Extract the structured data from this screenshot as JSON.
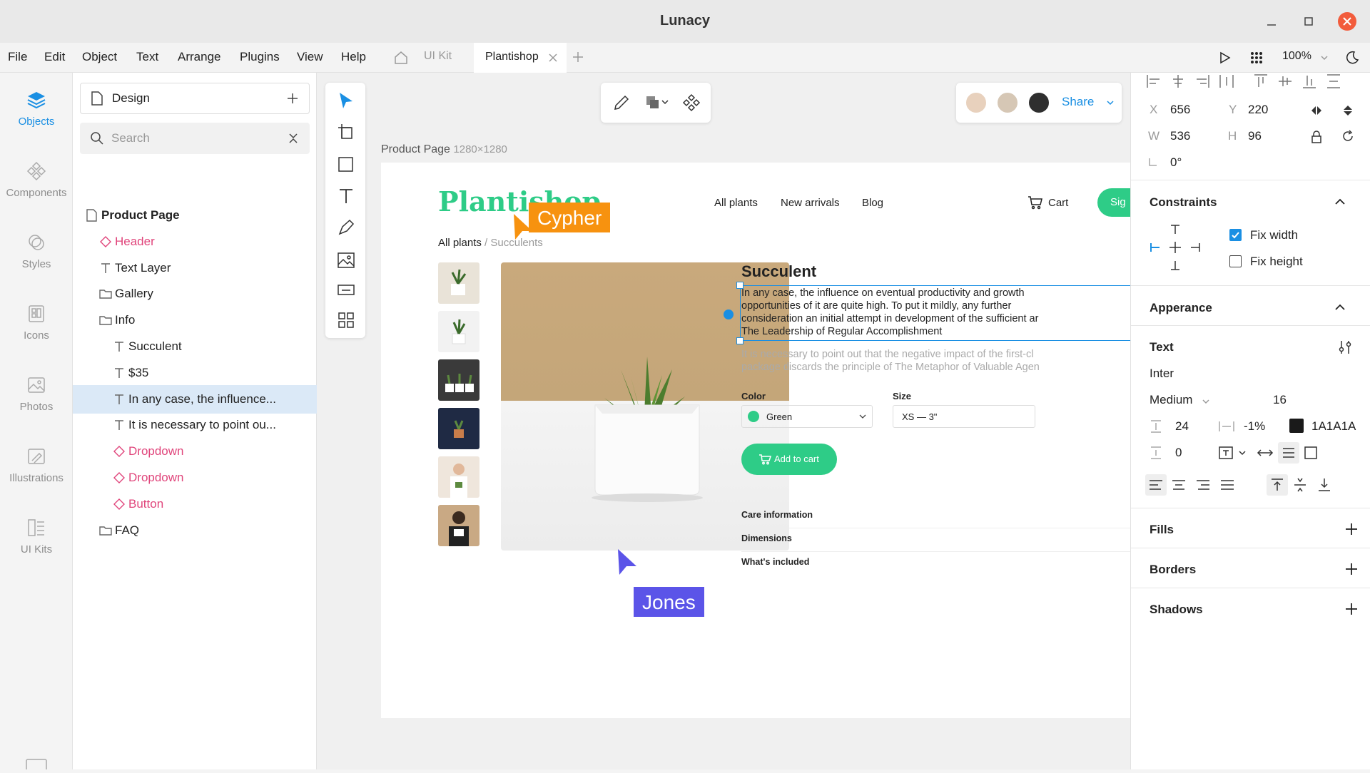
{
  "app": {
    "title": "Lunacy"
  },
  "menu": [
    "File",
    "Edit",
    "Object",
    "Text",
    "Arrange",
    "Plugins",
    "View",
    "Help"
  ],
  "tabs": {
    "kit": "UI Kit",
    "active": "Plantishop"
  },
  "toolbar_right": {
    "zoom": "100%"
  },
  "rail": [
    {
      "label": "Objects",
      "icon": "layers-icon",
      "active": true
    },
    {
      "label": "Components",
      "icon": "components-icon"
    },
    {
      "label": "Styles",
      "icon": "styles-icon"
    },
    {
      "label": "Icons",
      "icon": "icons-icon"
    },
    {
      "label": "Photos",
      "icon": "photos-icon"
    },
    {
      "label": "Illustrations",
      "icon": "illustrations-icon"
    },
    {
      "label": "UI Kits",
      "icon": "ui-kits-icon"
    }
  ],
  "pages": {
    "current": "Design"
  },
  "search": {
    "placeholder": "Search"
  },
  "layers": [
    {
      "label": "Product Page",
      "type": "page",
      "indent": 0,
      "color": "#222",
      "bold": true
    },
    {
      "label": "Header",
      "type": "component",
      "indent": 1,
      "color": "#e0457b"
    },
    {
      "label": "Text Layer",
      "type": "text",
      "indent": 1,
      "color": "#222"
    },
    {
      "label": "Gallery",
      "type": "folder",
      "indent": 1,
      "color": "#222"
    },
    {
      "label": "Info",
      "type": "folder",
      "indent": 1,
      "color": "#222"
    },
    {
      "label": "Succulent",
      "type": "text",
      "indent": 2,
      "color": "#222"
    },
    {
      "label": "$35",
      "type": "text",
      "indent": 2,
      "color": "#222"
    },
    {
      "label": "In any case, the influence...",
      "type": "text",
      "indent": 2,
      "color": "#222",
      "selected": true
    },
    {
      "label": "It is necessary to point ou...",
      "type": "text",
      "indent": 2,
      "color": "#222"
    },
    {
      "label": "Dropdown",
      "type": "component",
      "indent": 2,
      "color": "#e0457b"
    },
    {
      "label": "Dropdown",
      "type": "component",
      "indent": 2,
      "color": "#e0457b"
    },
    {
      "label": "Button",
      "type": "component",
      "indent": 2,
      "color": "#e0457b"
    },
    {
      "label": "FAQ",
      "type": "folder",
      "indent": 1,
      "color": "#222"
    }
  ],
  "artboard": {
    "name": "Product Page",
    "size": "1280×1280"
  },
  "share": {
    "label": "Share"
  },
  "site": {
    "logo": "Plantishop",
    "nav": [
      "All plants",
      "New arrivals",
      "Blog"
    ],
    "cart": "Cart",
    "signup": "Sig",
    "breadcrumb_root": "All plants",
    "breadcrumb_sep": "/",
    "breadcrumb_leaf": "Succulents",
    "product_title": "Succulent",
    "desc": "In any case, the influence on eventual productivity and growth opportunities of it are quite high. To put it mildly, any further consideration an initial attempt in development of the sufficient a The Leadership of Regular Accomplishment",
    "desc_lines": [
      "In any case, the influence on eventual productivity and growth",
      "opportunities of it are quite high. To put it mildly, any further",
      "consideration an initial attempt in development of the sufficient ar",
      "The Leadership of Regular Accomplishment"
    ],
    "desc2_lines": [
      "It is necessary to point out that the negative impact of the first-cl",
      "package discards the principle of The Metaphor of Valuable Agen"
    ],
    "color_label": "Color",
    "color_value": "Green",
    "color_swatch": "#2ecc87",
    "size_label": "Size",
    "size_value": "XS — 3\"",
    "add_to_cart": "Add to cart",
    "accordion": [
      "Care information",
      "Dimensions",
      "What's included"
    ]
  },
  "cursors": [
    {
      "name": "Cypher",
      "color": "#f7920f"
    },
    {
      "name": "Jones",
      "color": "#5b54e8"
    }
  ],
  "props": {
    "x": "656",
    "y": "220",
    "w": "536",
    "h": "96",
    "rotation": "0°",
    "constraints_title": "Constraints",
    "fix_width": "Fix width",
    "fix_height": "Fix height",
    "appearance_title": "Apperance",
    "text_title": "Text",
    "font": "Inter",
    "weight": "Medium",
    "font_size": "16",
    "line_height": "24",
    "letter_spacing": "-1%",
    "text_color": "1A1A1A",
    "paragraph": "0",
    "fills_title": "Fills",
    "borders_title": "Borders",
    "shadows_title": "Shadows",
    "labels": {
      "x": "X",
      "y": "Y",
      "w": "W",
      "h": "H"
    }
  },
  "colors": {
    "accent": "#1a8fe3",
    "brand_green": "#2ecc87",
    "selection": "#dbe9f7",
    "close": "#f25c3c"
  }
}
